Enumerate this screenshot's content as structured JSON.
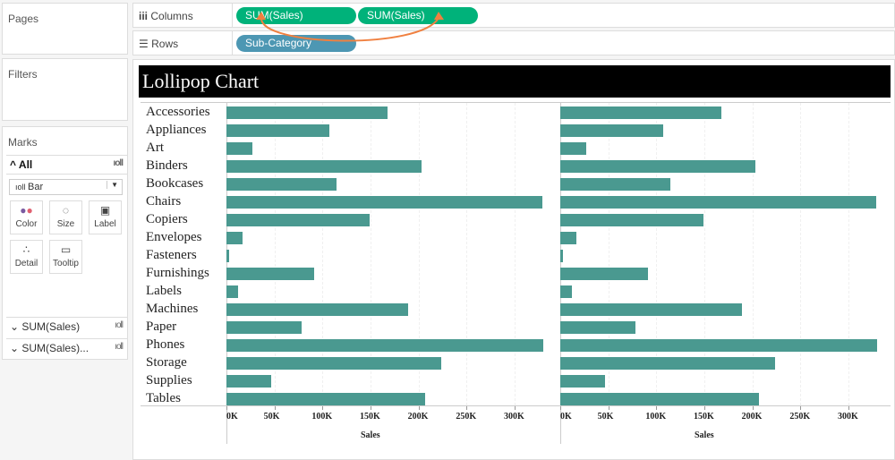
{
  "cards": {
    "pages": "Pages",
    "filters": "Filters",
    "marks": "Marks"
  },
  "shelves": {
    "columns_label": "Columns",
    "rows_label": "Rows",
    "columns": [
      "SUM(Sales)",
      "SUM(Sales)"
    ],
    "rows": [
      "Sub-Category"
    ]
  },
  "marks": {
    "all": "All",
    "mark_type": "Bar",
    "buttons": [
      {
        "label": "Color",
        "icon": "color-icon"
      },
      {
        "label": "Size",
        "icon": "size-icon"
      },
      {
        "label": "Label",
        "icon": "label-icon"
      },
      {
        "label": "Detail",
        "icon": "detail-icon"
      },
      {
        "label": "Tooltip",
        "icon": "tooltip-icon"
      }
    ],
    "cards": [
      "SUM(Sales)",
      "SUM(Sales)..."
    ]
  },
  "colors": {
    "bar": "#4a9990",
    "pill_measure": "#00b27a",
    "pill_dimension": "#4d97b3",
    "arrow": "#f08040"
  },
  "chart_data": {
    "type": "bar",
    "orientation": "horizontal",
    "title": "Lollipop Chart",
    "xlabel": "Sales",
    "xlim": [
      0,
      340000
    ],
    "categories": [
      "Accessories",
      "Appliances",
      "Art",
      "Binders",
      "Bookcases",
      "Chairs",
      "Copiers",
      "Envelopes",
      "Fasteners",
      "Furnishings",
      "Labels",
      "Machines",
      "Paper",
      "Phones",
      "Storage",
      "Supplies",
      "Tables"
    ],
    "values": [
      167380,
      107532,
      27119,
      203413,
      114880,
      328449,
      149528,
      16476,
      3024,
      91705,
      12486,
      189239,
      78479,
      330007,
      223844,
      46674,
      206966
    ],
    "ticks": [
      "0K",
      "50K",
      "100K",
      "150K",
      "200K",
      "250K",
      "300K"
    ],
    "panes": 2
  }
}
